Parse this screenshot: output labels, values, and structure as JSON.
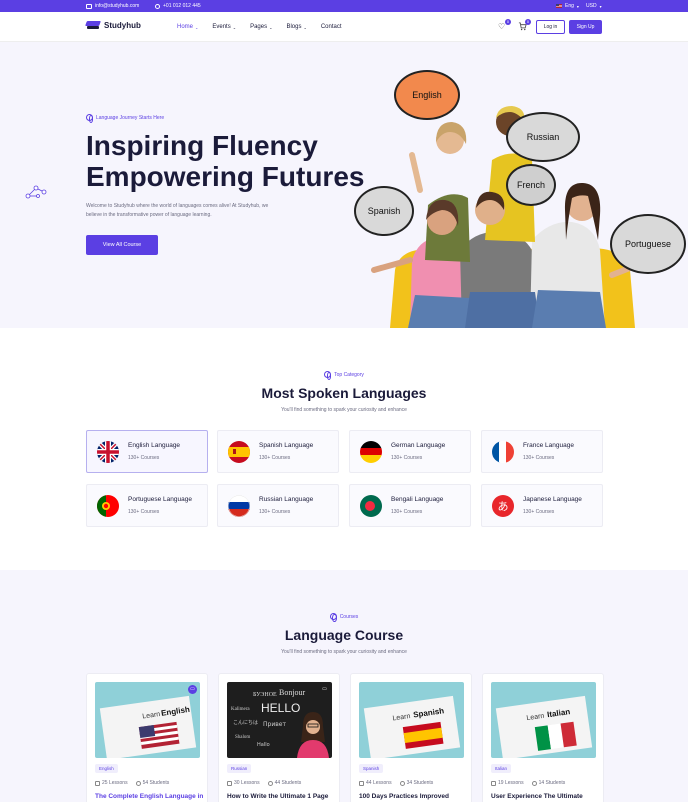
{
  "topbar": {
    "email": "info@studyhub.com",
    "phone": "+01 012 012 445",
    "language": "Eng",
    "currency": "USD"
  },
  "navbar": {
    "brand": "Studyhub",
    "menu": [
      {
        "label": "Home",
        "has_dropdown": true,
        "active": true
      },
      {
        "label": "Events",
        "has_dropdown": true
      },
      {
        "label": "Pages",
        "has_dropdown": true
      },
      {
        "label": "Blogs",
        "has_dropdown": true
      },
      {
        "label": "Contact",
        "has_dropdown": false
      }
    ],
    "wishlist_count": "0",
    "cart_count": "0",
    "login_label": "Log in",
    "signup_label": "Sign Up"
  },
  "hero": {
    "eyebrow": "Language Journey Starts Here",
    "title_line1": "Inspiring Fluency",
    "title_line2": "Empowering Futures",
    "description_line1": "Welcome to Studyhub where the world of languages comes alive! At Studyhub, we",
    "description_line2": "believe in the transformative power of language learning.",
    "cta_label": "View All Course",
    "bubbles": [
      "English",
      "Russian",
      "French",
      "Spanish",
      "Portuguese"
    ]
  },
  "categories": {
    "eyebrow": "Top Category",
    "title": "Most Spoken Languages",
    "subtitle": "You'll find something to spark your curiosity and enhance",
    "items": [
      {
        "name": "English Language",
        "count": "130+ Courses",
        "flag": "uk"
      },
      {
        "name": "Spanish Language",
        "count": "130+ Courses",
        "flag": "spain"
      },
      {
        "name": "German Language",
        "count": "130+ Courses",
        "flag": "germany"
      },
      {
        "name": "France Language",
        "count": "130+ Courses",
        "flag": "france"
      },
      {
        "name": "Portuguese Language",
        "count": "130+ Courses",
        "flag": "portugal"
      },
      {
        "name": "Russian Language",
        "count": "130+ Courses",
        "flag": "russia"
      },
      {
        "name": "Bengali Language",
        "count": "130+ Courses",
        "flag": "bangladesh"
      },
      {
        "name": "Japanese Language",
        "count": "130+ Courses",
        "flag": "japan"
      }
    ]
  },
  "courses": {
    "eyebrow": "Courses",
    "title": "Language Course",
    "subtitle": "You'll find something to spark your curiosity and enhance",
    "items": [
      {
        "tag": "English",
        "lessons": "25 Lessons",
        "students": "54 Students",
        "title": "The Complete English Language in",
        "image_word": "English",
        "board_word": "Learn"
      },
      {
        "tag": "Russian",
        "lessons": "30 Lessons",
        "students": "44 Students",
        "title": "How to Write the Ultimate 1 Page",
        "image_word": "HELLO",
        "board_word": "Bonjour"
      },
      {
        "tag": "Spanish",
        "lessons": "44 Lessons",
        "students": "34 Students",
        "title": "100 Days Practices Improved",
        "image_word": "Spanish",
        "board_word": "Learn"
      },
      {
        "tag": "Italian",
        "lessons": "19 Lessons",
        "students": "14 Students",
        "title": "User Experience The Ultimate",
        "image_word": "Italian",
        "board_word": "Learn"
      }
    ]
  },
  "colors": {
    "primary": "#5b3fe3",
    "heading": "#1b1b3a",
    "hero_bg": "#f6f5fd"
  }
}
